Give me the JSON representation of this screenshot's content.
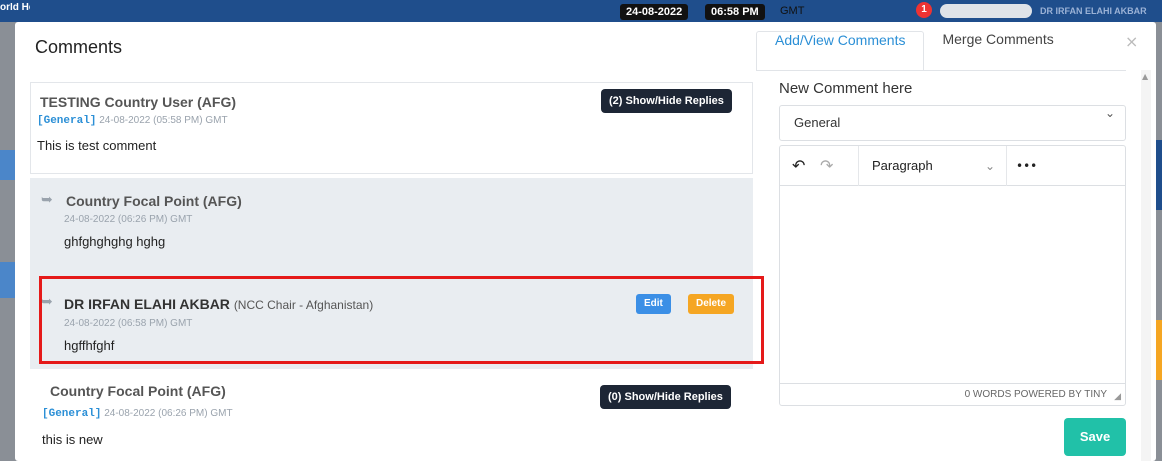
{
  "background": {
    "org_name": "orld Health Org",
    "date_badge": "24-08-2022",
    "time_badge": "06:58 PM",
    "tz": "GMT",
    "notification_count": "1",
    "user_name": "DR IRFAN ELAHI AKBAR"
  },
  "modal": {
    "title": "Comments",
    "close_glyph": "×",
    "tabs": [
      {
        "label": "Add/View Comments",
        "active": true
      },
      {
        "label": "Merge Comments",
        "active": false
      }
    ]
  },
  "comments": [
    {
      "author": "TESTING Country User (AFG)",
      "tag": "[General]",
      "timestamp": "24-08-2022 (05:58 PM) GMT",
      "text": "This is test comment",
      "replies_button": "(2) Show/Hide Replies"
    },
    {
      "author": "Country Focal Point (AFG)",
      "tag": "[General]",
      "timestamp": "24-08-2022 (06:26 PM) GMT",
      "text": "this is new",
      "replies_button": "(0) Show/Hide Replies"
    }
  ],
  "replies": [
    {
      "author": "Country Focal Point (AFG)",
      "timestamp": "24-08-2022 (06:26 PM) GMT",
      "text": "ghfghghghg hghg"
    },
    {
      "author": "DR IRFAN ELAHI AKBAR",
      "role": "(NCC Chair - Afghanistan)",
      "timestamp": "24-08-2022 (06:58 PM) GMT",
      "text": "hgffhfghf",
      "edit_label": "Edit",
      "delete_label": "Delete"
    }
  ],
  "editor": {
    "label": "New Comment here",
    "category_selected": "General",
    "paragraph_select": "Paragraph",
    "more_glyph": "•••",
    "status": "0 WORDS  POWERED BY TINY",
    "save_label": "Save"
  },
  "colors": {
    "accent": "#2b8fd6",
    "save": "#21c1a8",
    "delete": "#f5a623",
    "edit": "#3b8fe6",
    "highlight": "#e51a1a",
    "dark_button": "#1d2635"
  }
}
